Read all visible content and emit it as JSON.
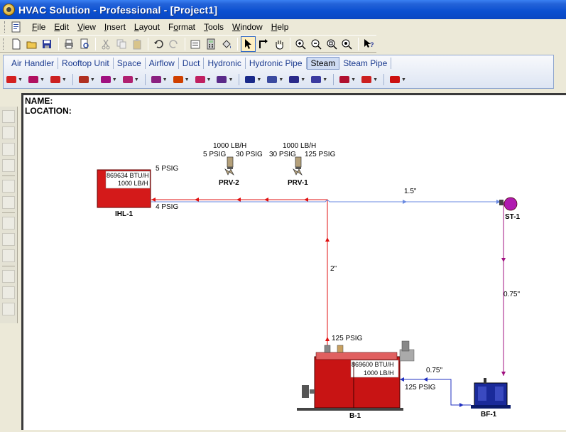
{
  "window": {
    "title": "HVAC Solution - Professional - [Project1]"
  },
  "menu": [
    {
      "label": "File",
      "key": "F"
    },
    {
      "label": "Edit",
      "key": "E"
    },
    {
      "label": "View",
      "key": "V"
    },
    {
      "label": "Insert",
      "key": "I"
    },
    {
      "label": "Layout",
      "key": "L"
    },
    {
      "label": "Format",
      "key": "o"
    },
    {
      "label": "Tools",
      "key": "T"
    },
    {
      "label": "Window",
      "key": "W"
    },
    {
      "label": "Help",
      "key": "H"
    }
  ],
  "toolbar": {
    "buttons": [
      "new-icon",
      "open-icon",
      "save-icon",
      "print-icon",
      "print-preview-icon",
      "cut-icon",
      "copy-icon",
      "paste-icon",
      "undo-icon",
      "redo-icon",
      "properties-icon",
      "calculator-icon",
      "paint-bucket-icon",
      "pointer-icon",
      "pipe-draw-icon",
      "hand-pan-icon",
      "zoom-in-icon",
      "zoom-out-icon",
      "zoom-extents-icon",
      "zoom-window-icon",
      "context-help-icon"
    ]
  },
  "category_tabs": [
    "Air Handler",
    "Rooftop Unit",
    "Space",
    "Airflow",
    "Duct",
    "Hydronic",
    "Hydronic Pipe",
    "Steam",
    "Steam Pipe"
  ],
  "selected_tab": "Steam",
  "equipment_palette": [
    "#d42020",
    "#b01060",
    "#cc2020",
    "#b03020",
    "#a01080",
    "#b02070",
    "#8a2080",
    "#d04000",
    "#c02060",
    "#5a2a8a",
    "#1a2a8a",
    "#3a4aa0",
    "#2a2a8a",
    "#3a3aa0",
    "#b01030",
    "#cc2020",
    "#cc1010"
  ],
  "drawing": {
    "name_label": "NAME:",
    "location_label": "LOCATION:",
    "ihl": {
      "id": "IHL-1",
      "btu": "869634 BTU/H",
      "flow": "1000 LB/H",
      "supply_psig": "5 PSIG",
      "return_psig": "4 PSIG"
    },
    "prv2": {
      "id": "PRV-2",
      "flow": "1000 LB/H",
      "in_psig": "30 PSIG",
      "out_psig": "5 PSIG"
    },
    "prv1": {
      "id": "PRV-1",
      "flow": "1000 LB/H",
      "in_psig": "125 PSIG",
      "out_psig": "30 PSIG"
    },
    "st": {
      "id": "ST-1"
    },
    "boiler": {
      "id": "B-1",
      "btu": "869600 BTU/H",
      "flow": "1000 LB/H",
      "out_psig": "125 PSIG",
      "in_psig": "125 PSIG"
    },
    "bf": {
      "id": "BF-1"
    },
    "pipe_labels": {
      "return_main": "1.5\"",
      "steam_riser": "2\"",
      "condensate_drop": "0.75\"",
      "feed_line": "0.75\""
    }
  },
  "colors": {
    "steam": "#e01010",
    "condensate": "#4a6ad0",
    "trap_line": "#a01080",
    "feed": "#2030c0",
    "equipment": "#d41a1a"
  }
}
